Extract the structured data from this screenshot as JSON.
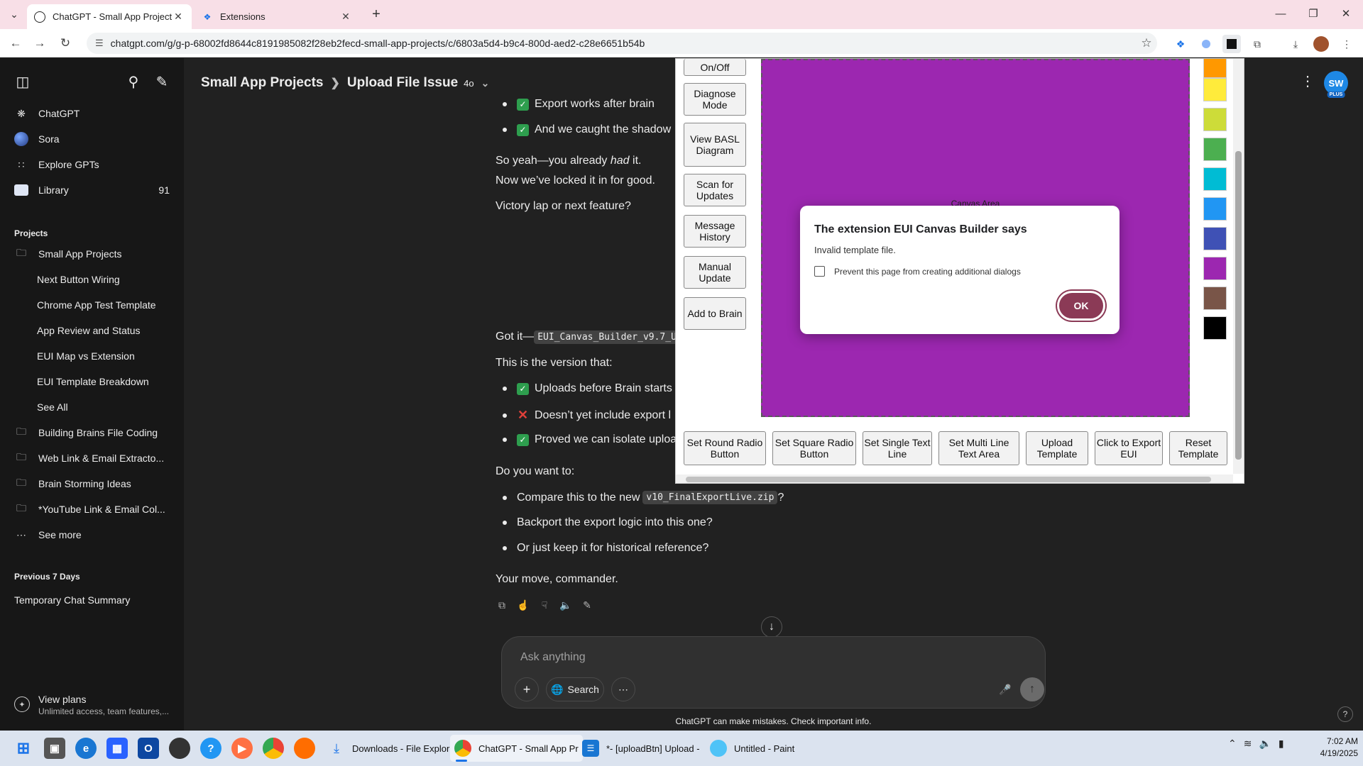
{
  "browser": {
    "tabs": [
      {
        "title": "ChatGPT - Small App Projects",
        "active": true
      },
      {
        "title": "Extensions",
        "active": false
      }
    ],
    "url": "chatgpt.com/g/g-p-68002fd8644c8191985082f28eb2fecd-small-app-projects/c/6803a5d4-b9c4-800d-aed2-c28e6651b54b"
  },
  "sidebar": {
    "nav": [
      {
        "label": "ChatGPT",
        "icon": "openai-icon"
      },
      {
        "label": "Sora",
        "icon": "sora-icon"
      },
      {
        "label": "Explore GPTs",
        "icon": "grid-icon"
      },
      {
        "label": "Library",
        "icon": "library-icon",
        "count": "91"
      }
    ],
    "projects_heading": "Projects",
    "projects": [
      {
        "label": "Small App Projects",
        "chats": [
          "Next Button Wiring",
          "Chrome App Test Template",
          "App Review and Status",
          "EUI Map vs Extension",
          "EUI Template Breakdown",
          "See All"
        ]
      },
      {
        "label": "Building Brains File Coding"
      },
      {
        "label": "Web Link & Email Extracto..."
      },
      {
        "label": "Brain Storming Ideas"
      },
      {
        "label": "*YouTube Link & Email Col..."
      }
    ],
    "see_more": "See more",
    "previous_heading": "Previous 7 Days",
    "previous_chats": [
      "Temporary Chat Summary"
    ],
    "view_plans": {
      "title": "View plans",
      "subtitle": "Unlimited access, team features,..."
    }
  },
  "header": {
    "project": "Small App Projects",
    "chat_title": "Upload File Issue",
    "model": "4o",
    "avatar_initials": "SW",
    "avatar_badge": "PLUS"
  },
  "conversation": {
    "bullets_top": [
      "Export works after brain",
      "And we caught the shadow"
    ],
    "line1_prefix": "So yeah—you already ",
    "line1_emph": "had",
    "line1_suffix": " it.",
    "line2": "Now we’ve locked it in for good.",
    "line3": "Victory lap or next feature?",
    "got_it": "Got it—",
    "got_it_code": "EUI_Canvas_Builder_v9.7_U",
    "version_line": "This is the version that:",
    "status_bullets": [
      {
        "mark": "check",
        "text": "Uploads before Brain starts"
      },
      {
        "mark": "cross",
        "text": "Doesn’t yet include export l"
      },
      {
        "mark": "check",
        "text": "Proved we can isolate uploa"
      }
    ],
    "question": "Do you want to:",
    "options": {
      "compare_prefix": "Compare this to the new ",
      "compare_code": "v10_FinalExportLive.zip",
      "compare_suffix": "?",
      "backport": "Backport the export logic into this one?",
      "keep": "Or just keep it for historical reference?"
    },
    "closing": "Your move, commander."
  },
  "composer": {
    "placeholder": "Ask anything",
    "search_label": "Search",
    "disclaimer": "ChatGPT can make mistakes. Check important info."
  },
  "extension": {
    "side_buttons": [
      "On/Off",
      "Diagnose Mode",
      "View BASL Diagram",
      "Scan for Updates",
      "Message History",
      "Manual Update",
      "Add to Brain"
    ],
    "canvas_label": "Canvas Area",
    "canvas_color": "#9c27b0",
    "swatches": [
      "#ff9800",
      "#ffeb3b",
      "#cddc39",
      "#4caf50",
      "#00bcd4",
      "#2196f3",
      "#3f51b5",
      "#9c27b0",
      "#795548",
      "#000000"
    ],
    "bottom_buttons": [
      "Set Round Radio Button",
      "Set Square Radio Button",
      "Set Single Text Line",
      "Set Multi Line Text Area",
      "Upload Template",
      "Click to Export EUI",
      "Reset Template"
    ]
  },
  "alert": {
    "title": "The extension EUI Canvas Builder says",
    "message": "Invalid template file.",
    "checkbox_label": "Prevent this page from creating additional dialogs",
    "ok_label": "OK"
  },
  "taskbar": {
    "apps": [
      {
        "label": "Downloads - File Explor",
        "icon": "download-icon"
      },
      {
        "label": "ChatGPT - Small App Pr",
        "icon": "chrome-icon",
        "active": true
      },
      {
        "label": "*- [uploadBtn] Upload -",
        "icon": "notepad-icon"
      },
      {
        "label": "Untitled - Paint",
        "icon": "paint-icon"
      }
    ],
    "time": "7:02 AM",
    "date": "4/19/2025"
  }
}
